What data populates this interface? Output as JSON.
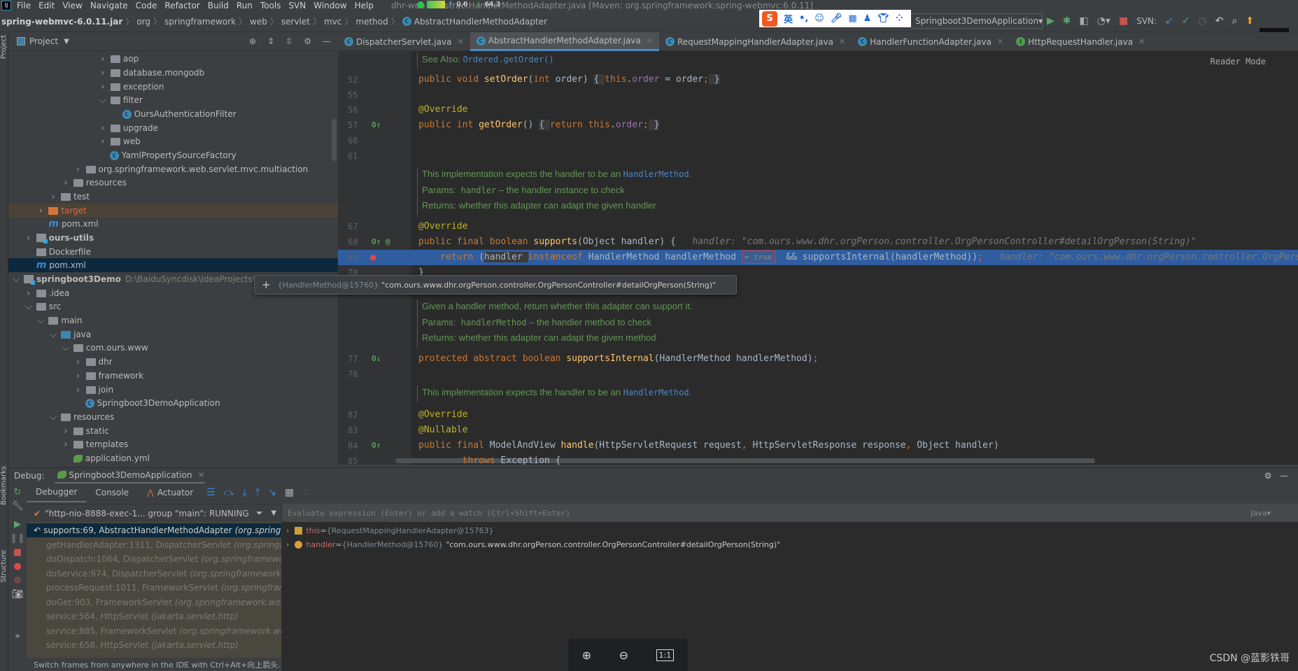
{
  "menu": {
    "items": [
      "File",
      "Edit",
      "View",
      "Navigate",
      "Code",
      "Refactor",
      "Build",
      "Run",
      "Tools",
      "SVN",
      "Window",
      "Help"
    ],
    "title": "dhr-web - AbstractHandlerMethodAdapter.java [Maven: org.springframework:spring-webmvc:6.0.11]",
    "net_up": "0.6",
    "net_down": "64.3"
  },
  "breadcrumb": [
    "spring-webmvc-6.0.11.jar",
    "org",
    "springframework",
    "web",
    "servlet",
    "mvc",
    "method",
    "AbstractHandlerMethodAdapter"
  ],
  "ime": {
    "logo": "S",
    "lang": "英",
    "punct": "•,"
  },
  "run_config": "Springboot3DemoApplication",
  "svn_label": "SVN:",
  "project": {
    "title": "Project",
    "side_label": "Project",
    "tree": [
      {
        "name": "aop",
        "level": 7,
        "icon": "package",
        "expander": "collapsed"
      },
      {
        "name": "database.mongodb",
        "level": 7,
        "icon": "package",
        "expander": "collapsed"
      },
      {
        "name": "exception",
        "level": 7,
        "icon": "package",
        "expander": "collapsed"
      },
      {
        "name": "filter",
        "level": 7,
        "icon": "package",
        "expander": "expanded"
      },
      {
        "name": "OursAuthenticationFilter",
        "level": 8,
        "icon": "class"
      },
      {
        "name": "upgrade",
        "level": 7,
        "icon": "package",
        "expander": "collapsed"
      },
      {
        "name": "web",
        "level": 7,
        "icon": "package",
        "expander": "collapsed"
      },
      {
        "name": "YamlPropertySourceFactory",
        "level": 7,
        "icon": "class"
      },
      {
        "name": "org.springframework.web.servlet.mvc.multiaction",
        "level": 5,
        "icon": "package",
        "expander": "collapsed"
      },
      {
        "name": "resources",
        "level": 4,
        "icon": "resources-folder",
        "expander": "collapsed"
      },
      {
        "name": "test",
        "level": 3,
        "icon": "folder",
        "expander": "collapsed"
      },
      {
        "name": "target",
        "level": 2,
        "icon": "excluded-folder",
        "expander": "collapsed",
        "state": "excluded"
      },
      {
        "name": "pom.xml",
        "level": 2,
        "icon": "maven"
      },
      {
        "name": "ours-utils",
        "level": 1,
        "icon": "module",
        "expander": "collapsed",
        "bold": true
      },
      {
        "name": "Dockerfile",
        "level": 1,
        "icon": "docker"
      },
      {
        "name": "pom.xml",
        "level": 1,
        "icon": "maven",
        "state": "selected"
      },
      {
        "name": "springboot3Demo",
        "level": 0,
        "icon": "module",
        "expander": "expanded",
        "bold": true,
        "path": "D:\\BaiduSyncdisk\\IdeaProjects\\sp"
      },
      {
        "name": ".idea",
        "level": 1,
        "icon": "folder",
        "expander": "collapsed"
      },
      {
        "name": "src",
        "level": 1,
        "icon": "folder",
        "expander": "expanded"
      },
      {
        "name": "main",
        "level": 2,
        "icon": "folder",
        "expander": "expanded"
      },
      {
        "name": "java",
        "level": 3,
        "icon": "source-folder",
        "expander": "expanded"
      },
      {
        "name": "com.ours.www",
        "level": 4,
        "icon": "package",
        "expander": "expanded"
      },
      {
        "name": "dhr",
        "level": 5,
        "icon": "package",
        "expander": "collapsed"
      },
      {
        "name": "framework",
        "level": 5,
        "icon": "package",
        "expander": "collapsed"
      },
      {
        "name": "join",
        "level": 5,
        "icon": "package",
        "expander": "collapsed"
      },
      {
        "name": "Springboot3DemoApplication",
        "level": 5,
        "icon": "spring-boot-class"
      },
      {
        "name": "resources",
        "level": 3,
        "icon": "resources-folder",
        "expander": "expanded"
      },
      {
        "name": "static",
        "level": 4,
        "icon": "folder",
        "expander": "collapsed"
      },
      {
        "name": "templates",
        "level": 4,
        "icon": "folder",
        "expander": "collapsed"
      },
      {
        "name": "application.yml",
        "level": 4,
        "icon": "spring-config"
      }
    ]
  },
  "tabs": [
    {
      "label": "DispatcherServlet.java",
      "icon": "class"
    },
    {
      "label": "AbstractHandlerMethodAdapter.java",
      "icon": "abstract-class",
      "active": true
    },
    {
      "label": "RequestMappingHandlerAdapter.java",
      "icon": "class"
    },
    {
      "label": "HandlerFunctionAdapter.java",
      "icon": "class"
    },
    {
      "label": "HttpRequestHandler.java",
      "icon": "interface"
    }
  ],
  "editor": {
    "reader_mode": "Reader Mode",
    "lines": [
      {
        "kind": "doc",
        "segs": [
          {
            "t": "See Also: "
          },
          {
            "t": "Ordered.getOrder()",
            "c": "dl"
          }
        ]
      },
      {
        "num": "52",
        "tokens": [
          {
            "t": "public void ",
            "c": "kw"
          },
          {
            "t": "setOrder",
            "c": "fn"
          },
          {
            "t": "(",
            "c": "pl"
          },
          {
            "t": "int ",
            "c": "kw"
          },
          {
            "t": "order) ",
            "c": "pl"
          },
          {
            "t": "{ ",
            "c": "pl brk"
          },
          {
            "t": "this",
            "c": "kw"
          },
          {
            "t": ".",
            "c": "pl"
          },
          {
            "t": "order",
            "c": "fld"
          },
          {
            "t": " = order",
            "c": "pl"
          },
          {
            "t": ";",
            "c": "kw"
          },
          {
            "t": " }",
            "c": "pl brk"
          }
        ]
      },
      {
        "num": "55",
        "tokens": []
      },
      {
        "num": "56",
        "tokens": [
          {
            "t": "@Override",
            "c": "ann"
          }
        ]
      },
      {
        "num": "57",
        "gutter": "override",
        "tokens": [
          {
            "t": "public int ",
            "c": "kw"
          },
          {
            "t": "getOrder",
            "c": "fn"
          },
          {
            "t": "() ",
            "c": "pl"
          },
          {
            "t": "{ ",
            "c": "pl brk"
          },
          {
            "t": "return this",
            "c": "kw"
          },
          {
            "t": ".",
            "c": "pl"
          },
          {
            "t": "order",
            "c": "fld"
          },
          {
            "t": ";",
            "c": "kw"
          },
          {
            "t": " }",
            "c": "pl brk"
          }
        ]
      },
      {
        "num": "60",
        "tokens": []
      },
      {
        "num": "61",
        "tokens": []
      },
      {
        "kind": "doc",
        "segs": [
          {
            "t": "This implementation expects the handler to be an "
          },
          {
            "t": "HandlerMethod",
            "c": "dl"
          },
          {
            "t": "."
          }
        ]
      },
      {
        "kind": "doc",
        "segs": [
          {
            "t": "Params:  "
          },
          {
            "t": "handler",
            "c": "dm"
          },
          {
            "t": " – the handler instance to check"
          }
        ]
      },
      {
        "kind": "doc",
        "segs": [
          {
            "t": "Returns: whether this adapter can adapt the given handler"
          }
        ]
      },
      {
        "num": "67",
        "tokens": [
          {
            "t": "@Override",
            "c": "ann"
          }
        ]
      },
      {
        "num": "68",
        "gutter": "override-at",
        "tokens": [
          {
            "t": "public final boolean ",
            "c": "kw"
          },
          {
            "t": "supports",
            "c": "fn"
          },
          {
            "t": "(Object handler) {   ",
            "c": "pl"
          },
          {
            "t": "handler: \"com.ours.www.dhr.orgPerson.controller.OrgPersonController#detailOrgPerson(String)\"",
            "c": "hint"
          }
        ]
      },
      {
        "num": "69",
        "gutter": "breakpoint",
        "exec": true,
        "tokens": [
          {
            "t": "    return ",
            "c": "kw"
          },
          {
            "t": "(",
            "c": "pl"
          },
          {
            "t": "handler ",
            "c": "pl brk"
          },
          {
            "t": "instanceof ",
            "c": "kw"
          },
          {
            "t": "HandlerMethod handlerMethod ",
            "c": "pl"
          },
          {
            "t": "= true",
            "c": "truebox"
          },
          {
            "t": "  && supportsInternal(handlerMethod))",
            "c": "pl"
          },
          {
            "t": ";",
            "c": "kw"
          },
          {
            "t": "   handler: \"com.ours.www.dhr.orgPerson.controller.OrgPerso",
            "c": "hint"
          }
        ]
      },
      {
        "num": "70",
        "tokens": [
          {
            "t": "}",
            "c": "pl"
          }
        ]
      },
      {
        "kind": "doc",
        "segs": [
          {
            "t": "Given a handler method, return whether this adapter can support it."
          }
        ]
      },
      {
        "kind": "doc",
        "segs": [
          {
            "t": "Params:  "
          },
          {
            "t": "handlerMethod",
            "c": "dm"
          },
          {
            "t": " – the handler method to check"
          }
        ]
      },
      {
        "kind": "doc",
        "segs": [
          {
            "t": "Returns: whether this adapter can adapt the given method"
          }
        ]
      },
      {
        "num": "77",
        "gutter": "implemented",
        "tokens": [
          {
            "t": "protected abstract boolean ",
            "c": "kw"
          },
          {
            "t": "supportsInternal",
            "c": "fn"
          },
          {
            "t": "(HandlerMethod handlerMethod)",
            "c": "pl"
          },
          {
            "t": ";",
            "c": "kw"
          }
        ]
      },
      {
        "num": "78",
        "tokens": []
      },
      {
        "kind": "doc",
        "segs": [
          {
            "t": "This implementation expects the handler to be an "
          },
          {
            "t": "HandlerMethod",
            "c": "dl"
          },
          {
            "t": "."
          }
        ]
      },
      {
        "num": "82",
        "tokens": [
          {
            "t": "@Override",
            "c": "ann"
          }
        ]
      },
      {
        "num": "83",
        "tokens": [
          {
            "t": "@Nullable",
            "c": "ann"
          }
        ]
      },
      {
        "num": "84",
        "gutter": "override",
        "tokens": [
          {
            "t": "public final ",
            "c": "kw"
          },
          {
            "t": "ModelAndView ",
            "c": "pl"
          },
          {
            "t": "handle",
            "c": "fn"
          },
          {
            "t": "(HttpServletRequest request",
            "c": "pl"
          },
          {
            "t": ", ",
            "c": "kw"
          },
          {
            "t": "HttpServletResponse response",
            "c": "pl"
          },
          {
            "t": ", ",
            "c": "kw"
          },
          {
            "t": "Object handler)",
            "c": "pl"
          }
        ]
      },
      {
        "num": "85",
        "tokens": [
          {
            "t": "        throws ",
            "c": "kw"
          },
          {
            "t": "Exception {",
            "c": "pl"
          }
        ]
      }
    ]
  },
  "tooltip": {
    "id": "{HandlerMethod@15760}",
    "value": "\"com.ours.www.dhr.orgPerson.controller.OrgPersonController#detailOrgPerson(String)\""
  },
  "debug": {
    "label": "Debug:",
    "session": "Springboot3DemoApplication",
    "tabs": [
      "Debugger",
      "Console",
      "Actuator"
    ],
    "thread": "\"http-nio-8888-exec-1... group \"main\": RUNNING",
    "frames": [
      {
        "method": "supports:69, AbstractHandlerMethodAdapter",
        "pkg": "(org.springfra",
        "current": true
      },
      {
        "method": "getHandlerAdapter:1311, DispatcherServlet",
        "pkg": "(org.springfram"
      },
      {
        "method": "doDispatch:1064, DispatcherServlet",
        "pkg": "(org.springframework.w"
      },
      {
        "method": "doService:974, DispatcherServlet",
        "pkg": "(org.springframework.we"
      },
      {
        "method": "processRequest:1011, FrameworkServlet",
        "pkg": "(org.springframew"
      },
      {
        "method": "doGet:903, FrameworkServlet",
        "pkg": "(org.springframework.web.se"
      },
      {
        "method": "service:564, HttpServlet",
        "pkg": "(jakarta.servlet.http)"
      },
      {
        "method": "service:885, FrameworkServlet",
        "pkg": "(org.springframework.web.s"
      },
      {
        "method": "service:658, HttpServlet",
        "pkg": "(jakarta.servlet.http)"
      }
    ],
    "hint": "Switch frames from anywhere in the IDE with Ctrl+Alt+向上箭头...",
    "eval_placeholder": "Evaluate expression (Enter) or add a watch (Ctrl+Shift+Enter)",
    "eval_lang": "Java▾",
    "variables": [
      {
        "name": "this",
        "id": "{RequestMappingHandlerAdapter@15763}",
        "value": "",
        "icon": "field"
      },
      {
        "name": "handler",
        "id": "{HandlerMethod@15760}",
        "value": "\"com.ours.www.dhr.orgPerson.controller.OrgPersonController#detailOrgPerson(String)\"",
        "icon": "parameter"
      }
    ]
  },
  "side_labels": {
    "bookmarks": "Bookmarks",
    "structure": "Structure"
  },
  "zoom_controls": {
    "one_to_one": "1:1"
  },
  "watermark": "CSDN @蓝影铁哥"
}
